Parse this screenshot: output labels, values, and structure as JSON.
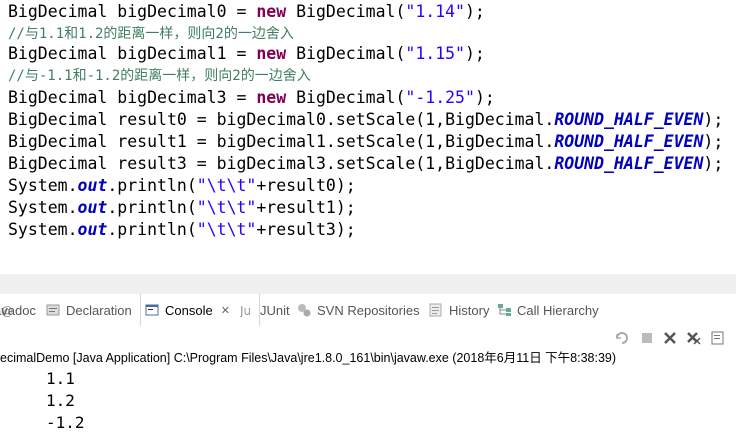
{
  "editor": {
    "lines": [
      {
        "seg": [
          "BigDecimal bigDecimal0 = ",
          "new",
          " BigDecimal(",
          "\"1.14\"",
          ");"
        ]
      },
      {
        "comment": "//与1.1和1.2的距离一样，则向2的一边舍入"
      },
      {
        "seg": [
          "BigDecimal bigDecimal1 = ",
          "new",
          " BigDecimal(",
          "\"1.15\"",
          ");"
        ]
      },
      {
        "comment": "//与-1.1和-1.2的距离一样，则向2的一边舍入"
      },
      {
        "seg": [
          "BigDecimal bigDecimal3 = ",
          "new",
          " BigDecimal(",
          "\"-1.25\"",
          ");"
        ]
      },
      {
        "seg": [
          "BigDecimal result0 = bigDecimal0.setScale(1,BigDecimal.",
          "ROUND_HALF_EVEN",
          ");"
        ]
      },
      {
        "seg": [
          "BigDecimal result1 = bigDecimal1.setScale(1,BigDecimal.",
          "ROUND_HALF_EVEN",
          ");"
        ]
      },
      {
        "seg": [
          "BigDecimal result3 = bigDecimal3.setScale(1,BigDecimal.",
          "ROUND_HALF_EVEN",
          ");"
        ]
      },
      {
        "seg": [
          "System.",
          "out",
          ".println(",
          "\"\\t\\t\"",
          "+result0);"
        ]
      },
      {
        "seg": [
          "System.",
          "out",
          ".println(",
          "\"\\t\\t\"",
          "+result1);"
        ]
      },
      {
        "seg": [
          "System.",
          "out",
          ".println(",
          "\"\\t\\t\"",
          "+result3);"
        ]
      }
    ]
  },
  "tabs": [
    {
      "label": "avadoc",
      "icon": "javadoc-icon"
    },
    {
      "label": "Declaration",
      "icon": "declaration-icon"
    },
    {
      "label": "Console",
      "icon": "console-icon",
      "active": true,
      "close": "✕"
    },
    {
      "label": "JUnit",
      "icon": "junit-icon"
    },
    {
      "label": "SVN Repositories",
      "icon": "svn-icon"
    },
    {
      "label": "History",
      "icon": "history-icon"
    },
    {
      "label": "Call Hierarchy",
      "icon": "call-hierarchy-icon"
    }
  ],
  "console": {
    "status": "ecimalDemo [Java Application] C:\\Program Files\\Java\\jre1.8.0_161\\bin\\javaw.exe (2018年6月11日 下午8:38:39)",
    "output": [
      "1.1",
      "1.2",
      "-1.2"
    ]
  },
  "colors": {
    "keyword": "#7f0055",
    "string": "#2a00ff",
    "comment": "#3f7f5f",
    "field": "#0000c0"
  }
}
